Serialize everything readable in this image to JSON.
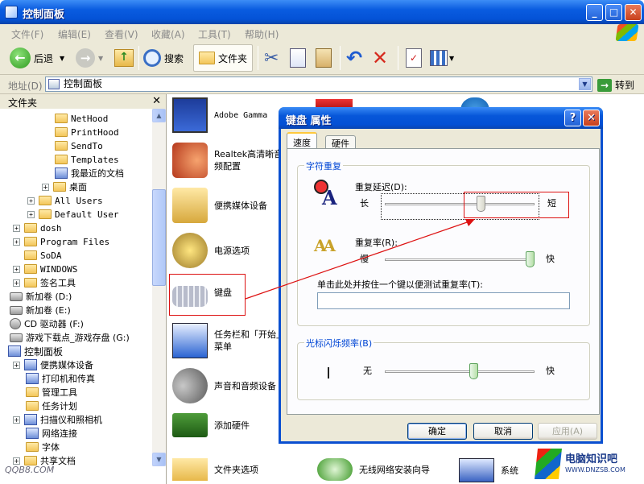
{
  "window": {
    "title": "控制面板"
  },
  "menu": [
    "文件(F)",
    "编辑(E)",
    "查看(V)",
    "收藏(A)",
    "工具(T)",
    "帮助(H)"
  ],
  "toolbar": {
    "back": "后退",
    "search": "搜索",
    "folders": "文件夹"
  },
  "address": {
    "label": "地址(D)",
    "value": "控制面板",
    "go": "转到"
  },
  "folders_pane": {
    "title": "文件夹",
    "items": [
      "NetHood",
      "PrintHood",
      "SendTo",
      "Templates",
      "我最近的文档",
      "桌面",
      "All Users",
      "Default User",
      "dosh",
      "Program Files",
      "SoDA",
      "WINDOWS",
      "签名工具",
      "新加卷 (D:)",
      "新加卷 (E:)",
      "CD 驱动器 (F:)",
      "游戏下载点_游戏存盘 (G:)",
      "控制面板",
      "便携媒体设备",
      "打印机和传真",
      "管理工具",
      "任务计划",
      "扫描仪和照相机",
      "网络连接",
      "字体",
      "共享文档"
    ]
  },
  "cp_items": [
    "Adobe Gamma",
    "Realtek高清晰音频配置",
    "便携媒体设备",
    "电源选项",
    "键盘",
    "任务栏和「开始」菜单",
    "声音和音频设备",
    "添加硬件",
    "文件夹选项",
    "无线网络安装向导",
    "系统"
  ],
  "dialog": {
    "title": "键盘 属性",
    "tabs": [
      "速度",
      "硬件"
    ],
    "group1": "字符重复",
    "delay_label": "重复延迟(D):",
    "delay_long": "长",
    "delay_short": "短",
    "rate_label": "重复率(R):",
    "rate_slow": "慢",
    "rate_fast": "快",
    "test_label": "单击此处并按住一个键以便测试重复率(T):",
    "test_value": "",
    "group2": "光标闪烁频率(B)",
    "blink_none": "无",
    "blink_fast": "快",
    "ok": "确定",
    "cancel": "取消",
    "apply": "应用(A)",
    "delay_level": 0.65,
    "rate_level": 1.0,
    "blink_level": 0.6
  },
  "watermark_left": "QQB8.COM",
  "watermark_right": {
    "text": "电脑知识吧",
    "url": "WWW.DNZSB.COM"
  },
  "colors": {
    "titlebar": "#0a5ce0",
    "highlight_box": "#dd1111",
    "accent_tab": "#ffc83c"
  }
}
